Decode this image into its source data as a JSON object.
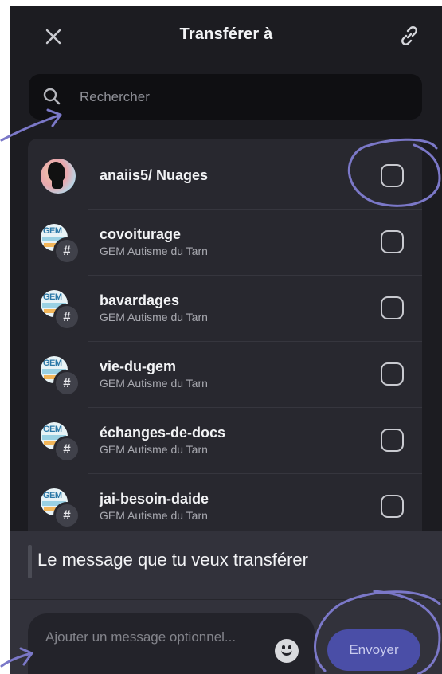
{
  "header": {
    "title": "Transférer à",
    "close_icon": "close-icon",
    "link_icon": "link-icon"
  },
  "search": {
    "placeholder": "Rechercher",
    "icon": "search-icon"
  },
  "destinations": [
    {
      "title": "anaiis5/ Nuages",
      "subtitle": "",
      "type": "user",
      "checked": false
    },
    {
      "title": "covoiturage",
      "subtitle": "GEM Autisme du Tarn",
      "type": "channel",
      "checked": false
    },
    {
      "title": "bavardages",
      "subtitle": "GEM Autisme du Tarn",
      "type": "channel",
      "checked": false
    },
    {
      "title": "vie-du-gem",
      "subtitle": "GEM Autisme du Tarn",
      "type": "channel",
      "checked": false
    },
    {
      "title": "échanges-de-docs",
      "subtitle": "GEM Autisme du Tarn",
      "type": "channel",
      "checked": false
    },
    {
      "title": "jai-besoin-daide",
      "subtitle": "GEM Autisme du Tarn",
      "type": "channel",
      "checked": false
    }
  ],
  "forwarded_message": {
    "text": "Le message que tu veux transférer"
  },
  "compose": {
    "placeholder": "Ajouter un message optionnel...",
    "emoji_icon": "emoji-icon",
    "send_label": "Envoyer"
  },
  "colors": {
    "background": "#1c1c21",
    "list_bg": "#28282f",
    "accent": "#4a4ea7",
    "annotation": "#7b78c8"
  }
}
